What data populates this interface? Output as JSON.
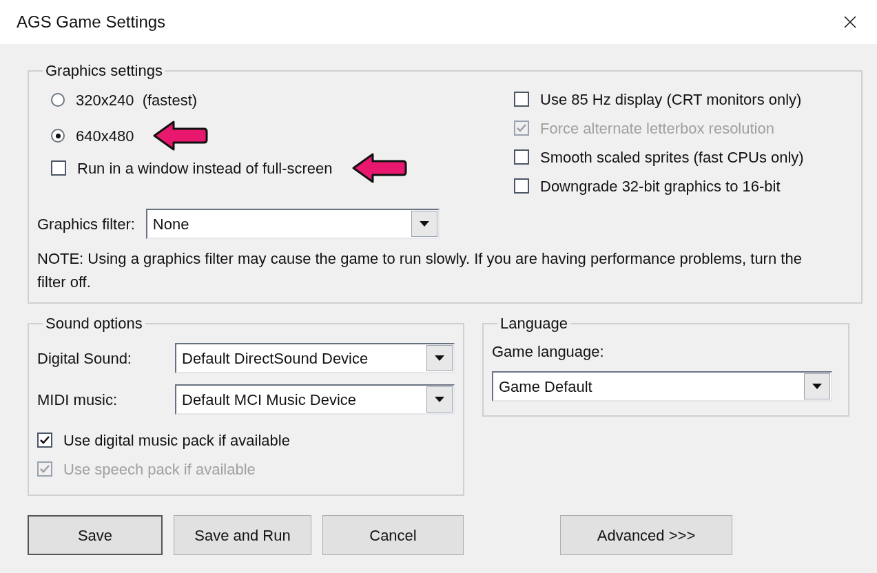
{
  "window": {
    "title": "AGS Game Settings"
  },
  "graphics": {
    "legend": "Graphics settings",
    "resolutions": [
      {
        "label": "320x240  (fastest)",
        "selected": false,
        "highlighted": false
      },
      {
        "label": "640x480",
        "selected": true,
        "highlighted": true
      }
    ],
    "window_check": {
      "label": "Run in a window instead of full-screen",
      "checked": false,
      "disabled": false,
      "highlighted": true
    },
    "filter": {
      "label": "Graphics filter:",
      "value": "None"
    },
    "note": "NOTE: Using a graphics filter may cause the game to run slowly. If you are having performance problems, turn the filter off.",
    "options": [
      {
        "label": "Use 85 Hz display (CRT monitors only)",
        "checked": false,
        "disabled": false
      },
      {
        "label": "Force alternate letterbox resolution",
        "checked": true,
        "disabled": true
      },
      {
        "label": "Smooth scaled sprites (fast CPUs only)",
        "checked": false,
        "disabled": false
      },
      {
        "label": "Downgrade 32-bit graphics to 16-bit",
        "checked": false,
        "disabled": false
      }
    ]
  },
  "sound": {
    "legend": "Sound options",
    "selects": [
      {
        "label": "Digital Sound:",
        "value": "Default DirectSound Device"
      },
      {
        "label": "MIDI music:",
        "value": "Default MCI Music Device"
      }
    ],
    "options": [
      {
        "label": "Use digital music pack if available",
        "checked": true,
        "disabled": false
      },
      {
        "label": "Use speech pack if available",
        "checked": true,
        "disabled": true
      }
    ]
  },
  "language": {
    "legend": "Language",
    "label": "Game language:",
    "value": "Game Default"
  },
  "buttons": [
    {
      "label": "Save",
      "default": true
    },
    {
      "label": "Save and Run",
      "default": false
    },
    {
      "label": "Cancel",
      "default": false
    },
    {
      "label": "Advanced >>>",
      "default": false
    }
  ]
}
